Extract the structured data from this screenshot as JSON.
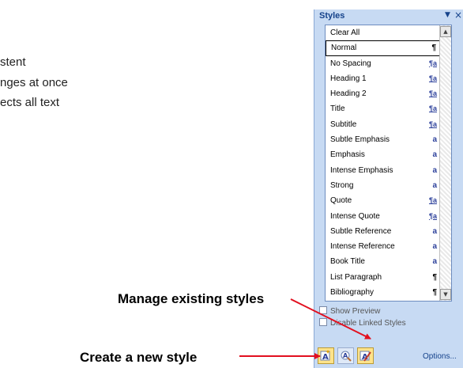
{
  "background": {
    "lines": [
      "stent",
      "nges at once",
      "ects all text"
    ]
  },
  "callouts": {
    "manage": "Manage existing styles",
    "create": "Create a new style"
  },
  "pane": {
    "title": "Styles",
    "menu_icon": "dropdown-triangle-icon",
    "close_icon": "close-icon"
  },
  "styles_list": [
    {
      "name": "Clear All",
      "mark": ""
    },
    {
      "name": "Normal",
      "mark": "¶",
      "selected": true
    },
    {
      "name": "No Spacing",
      "mark": "¶a"
    },
    {
      "name": "Heading 1",
      "mark": "¶a"
    },
    {
      "name": "Heading 2",
      "mark": "¶a"
    },
    {
      "name": "Title",
      "mark": "¶a"
    },
    {
      "name": "Subtitle",
      "mark": "¶a"
    },
    {
      "name": "Subtle Emphasis",
      "mark": "a"
    },
    {
      "name": "Emphasis",
      "mark": "a"
    },
    {
      "name": "Intense Emphasis",
      "mark": "a"
    },
    {
      "name": "Strong",
      "mark": "a"
    },
    {
      "name": "Quote",
      "mark": "¶a"
    },
    {
      "name": "Intense Quote",
      "mark": "¶a"
    },
    {
      "name": "Subtle Reference",
      "mark": "a"
    },
    {
      "name": "Intense Reference",
      "mark": "a"
    },
    {
      "name": "Book Title",
      "mark": "a"
    },
    {
      "name": "List Paragraph",
      "mark": "¶"
    },
    {
      "name": "Bibliography",
      "mark": "¶"
    }
  ],
  "options": {
    "show_preview": "Show Preview",
    "disable_linked": "Disable Linked Styles",
    "options_link": "Options..."
  },
  "colors": {
    "arrow": "#e2101f",
    "pane_bg": "#c7daf3",
    "title_text": "#15428b"
  }
}
